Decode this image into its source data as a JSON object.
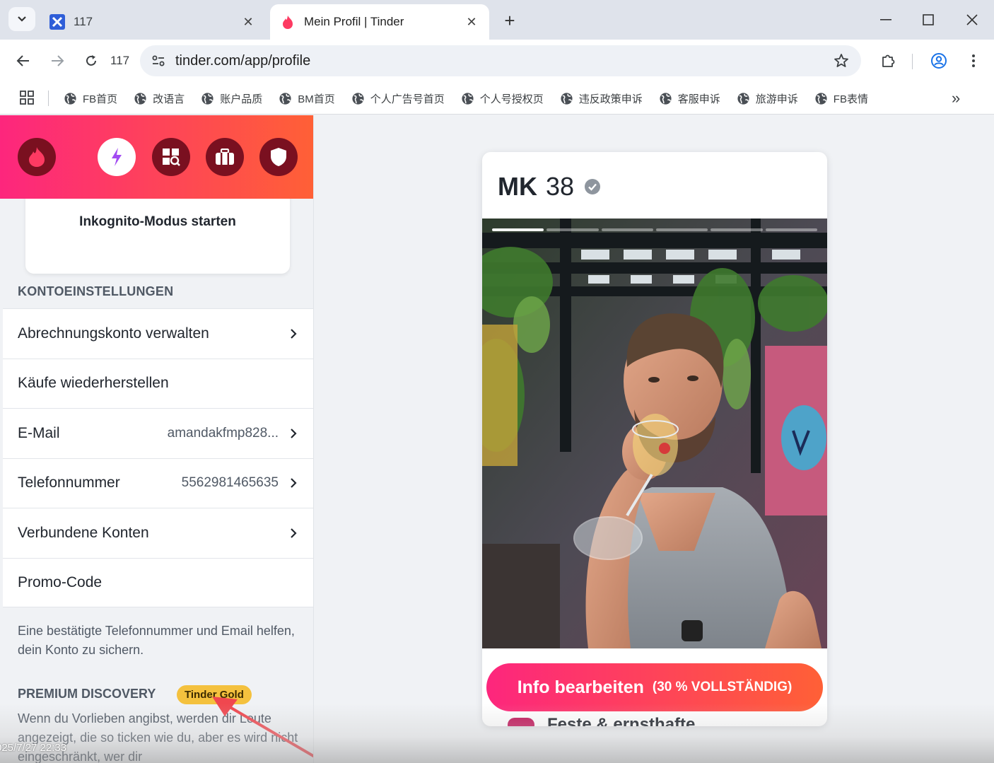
{
  "browser": {
    "tabs": [
      {
        "title": "117",
        "icon": "x-logo-icon"
      },
      {
        "title": "Mein Profil | Tinder",
        "icon": "tinder-flame-icon"
      }
    ],
    "reload_count": "117",
    "url": "tinder.com/app/profile",
    "bookmarks": [
      "FB首页",
      "改语言",
      "账户品质",
      "BM首页",
      "个人广告号首页",
      "个人号授权页",
      "违反政策申诉",
      "客服申诉",
      "旅游申诉",
      "FB表情"
    ],
    "more_bookmarks": "»"
  },
  "sidebar": {
    "header_buttons": [
      "tinder-flame-icon",
      "boost-bolt-icon",
      "explore-icon",
      "briefcase-icon",
      "shield-icon"
    ],
    "incognito_label": "Inkognito-Modus starten",
    "account_section_title": "KONTOEINSTELLUNGEN",
    "account_rows": [
      {
        "label": "Abrechnungskonto verwalten",
        "value": "",
        "chevron": true
      },
      {
        "label": "Käufe wiederherstellen",
        "value": "",
        "chevron": false
      },
      {
        "label": "E-Mail",
        "value": "amandakfmp828...",
        "chevron": true
      },
      {
        "label": "Telefonnummer",
        "value": "5562981465635",
        "chevron": true
      },
      {
        "label": "Verbundene Konten",
        "value": "",
        "chevron": true
      },
      {
        "label": "Promo-Code",
        "value": "",
        "chevron": false
      }
    ],
    "help_text": "Eine bestätigte Telefonnummer und Email helfen, dein Konto zu sichern.",
    "premium_title": "PREMIUM DISCOVERY",
    "premium_badge": "Tinder Gold",
    "premium_text": "Wenn du Vorlieben angibst, werden dir Leute angezeigt, die so ticken wie du, aber es wird nicht eingeschränkt, wer dir"
  },
  "profile": {
    "name": "MK",
    "age": "38",
    "verified": true,
    "photo_count": 6,
    "photo_index": 1,
    "edit_button": "Info bearbeiten",
    "completion": "(30 % VOLLSTÄNDIG)",
    "next_section": "Feste & ernsthafte"
  },
  "overlay": {
    "timestamp": "025/7/27 22:33"
  },
  "colors": {
    "tinder_gradient_start": "#fd267d",
    "tinder_gradient_end": "#ff6036",
    "gold": "#f4c13e",
    "annotation_arrow": "#f0474f"
  }
}
